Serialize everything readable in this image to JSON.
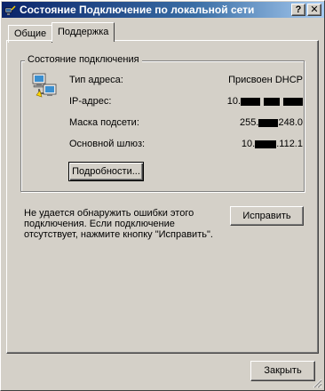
{
  "window": {
    "title": "Состояние Подключение по локальной сети",
    "help_glyph": "?",
    "close_glyph": "✕"
  },
  "tabs": [
    {
      "label": "Общие",
      "active": false
    },
    {
      "label": "Поддержка",
      "active": true
    }
  ],
  "connection_status": {
    "legend": "Состояние подключения",
    "rows": [
      {
        "label": "Тип адреса:",
        "value": "Присвоен DHCP"
      },
      {
        "label": "IP-адрес:",
        "value_prefix": "10.",
        "value_suffix": ""
      },
      {
        "label": "Маска подсети:",
        "value_prefix": "255.",
        "value_suffix": "248.0"
      },
      {
        "label": "Основной шлюз:",
        "value_prefix": "10.",
        "value_suffix": ".112.1"
      }
    ],
    "details_button": "Подробности..."
  },
  "repair": {
    "message": "Не удается обнаружить ошибки этого подключения. Если подключение отсутствует, нажмите кнопку \"Исправить\".",
    "repair_button": "Исправить"
  },
  "footer": {
    "close_button": "Закрыть"
  },
  "colors": {
    "face": "#d4d0c8",
    "title_start": "#0a246a",
    "title_end": "#a6caf0"
  }
}
